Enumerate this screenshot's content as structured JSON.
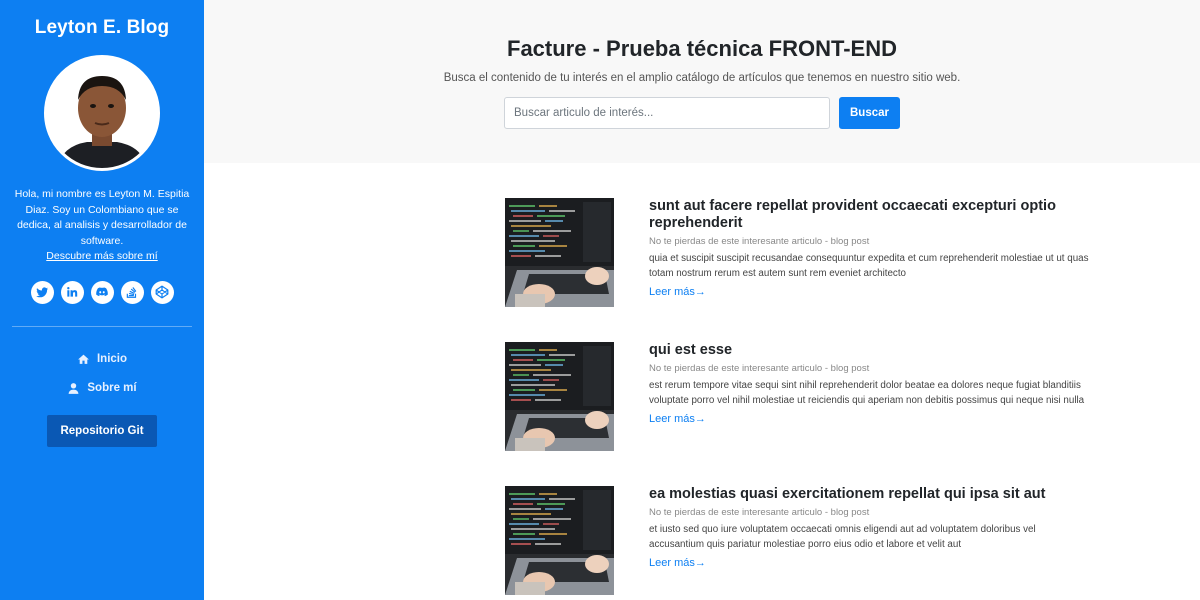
{
  "sidebar": {
    "brand": "Leyton E. Blog",
    "bio": "Hola, mi nombre es Leyton M. Espitia Diaz. Soy un Colombiano que se dedica, al analisis y desarrollador de software.",
    "bio_link": "Descubre más sobre mí",
    "socials": [
      "twitter-icon",
      "linkedin-icon",
      "discord-icon",
      "stackoverflow-icon",
      "codepen-icon"
    ],
    "nav": [
      {
        "label": "Inicio",
        "icon": "home-icon"
      },
      {
        "label": "Sobre mí",
        "icon": "user-icon"
      }
    ],
    "repo_button": "Repositorio Git"
  },
  "hero": {
    "title": "Facture - Prueba técnica FRONT-END",
    "subtitle": "Busca el contenido de tu interés en el amplio catálogo de artículos que tenemos en nuestro sitio web.",
    "search_placeholder": "Buscar articulo de interés...",
    "search_button": "Buscar"
  },
  "posts": [
    {
      "title": "sunt aut facere repellat provident occaecati excepturi optio reprehenderit",
      "meta": "No te pierdas de este interesante articulo - blog post",
      "body": "quia et suscipit suscipit recusandae consequuntur expedita et cum reprehenderit molestiae ut ut quas totam nostrum rerum est autem sunt rem eveniet architecto",
      "more": "Leer más→"
    },
    {
      "title": "qui est esse",
      "meta": "No te pierdas de este interesante articulo - blog post",
      "body": "est rerum tempore vitae sequi sint nihil reprehenderit dolor beatae ea dolores neque fugiat blanditiis voluptate porro vel nihil molestiae ut reiciendis qui aperiam non debitis possimus qui neque nisi nulla",
      "more": "Leer más→"
    },
    {
      "title": "ea molestias quasi exercitationem repellat qui ipsa sit aut",
      "meta": "No te pierdas de este interesante articulo - blog post",
      "body": "et iusto sed quo iure voluptatem occaecati omnis eligendi aut ad voluptatem doloribus vel accusantium quis pariatur molestiae porro eius odio et labore et velit aut",
      "more": "Leer más→"
    }
  ],
  "colors": {
    "sidebar_bg": "#0d7ff2",
    "accent": "#0d7ff2",
    "repo_button_bg": "#0a58b4",
    "hero_bg": "#f8f8f8"
  }
}
